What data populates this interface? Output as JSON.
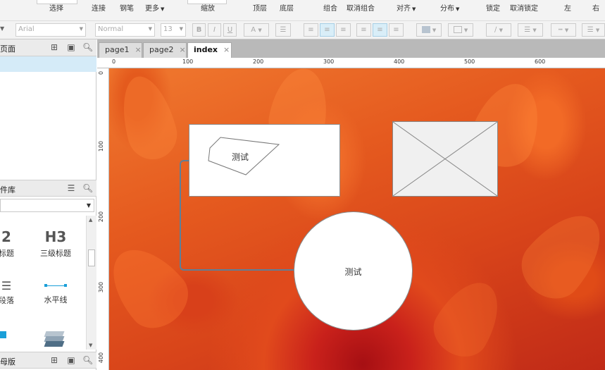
{
  "toolbar": {
    "items": [
      "选择",
      "连接",
      "钢笔",
      "更多",
      "缩放",
      "顶层",
      "底层",
      "组合",
      "取消组合",
      "对齐",
      "分布",
      "锁定",
      "取消锁定",
      "左",
      "右"
    ]
  },
  "format_bar": {
    "font_family": "Arial",
    "font_style": "Normal",
    "font_size": "13",
    "bold": "B",
    "italic": "I",
    "underline": "U",
    "text_color": "A"
  },
  "pages_panel": {
    "title": "页面"
  },
  "library_panel": {
    "title": "件库",
    "widgets": [
      {
        "icon_text": "2",
        "label": "标题"
      },
      {
        "icon_text": "H3",
        "label": "三级标题"
      },
      {
        "icon_text": "",
        "label": "段落"
      },
      {
        "icon_text": "",
        "label": "水平线"
      }
    ]
  },
  "masters_panel": {
    "title": "母版"
  },
  "tabs": [
    {
      "label": "page1",
      "close": "×"
    },
    {
      "label": "page2",
      "close": "×"
    },
    {
      "label": "index",
      "close": "×"
    }
  ],
  "ruler": {
    "h_ticks": [
      "0",
      "100",
      "200",
      "300",
      "400",
      "500",
      "600"
    ],
    "v_ticks": [
      "0",
      "100",
      "200",
      "300",
      "400"
    ]
  },
  "canvas": {
    "rect_label": "测试",
    "circle_label": "测试"
  },
  "colors": {
    "selection": "#d5ebf8",
    "connector": "#5e7f98",
    "accent_blue": "#1a9fd8"
  }
}
